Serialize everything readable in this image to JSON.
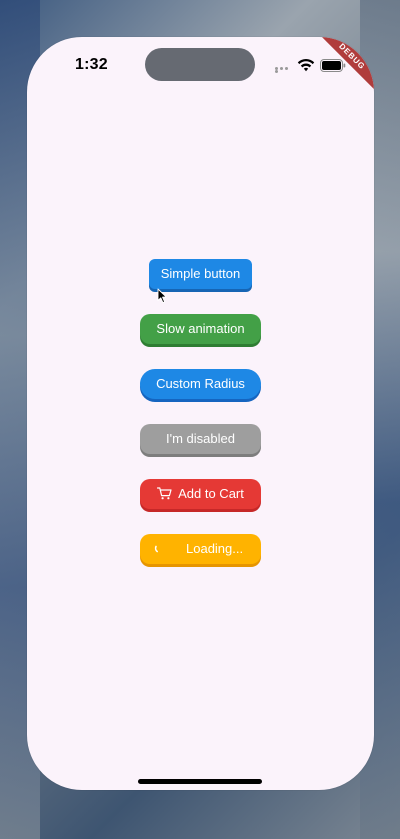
{
  "status_bar": {
    "time": "1:32"
  },
  "debug_banner": {
    "label": "DEBUG"
  },
  "buttons": {
    "simple": "Simple button",
    "slow": "Slow animation",
    "radius": "Custom Radius",
    "disabled": "I'm disabled",
    "cart": "Add to Cart",
    "loading": "Loading..."
  },
  "icons": {
    "cart": "shopping-cart-icon",
    "spinner": "spinner-icon",
    "wifi": "wifi-icon",
    "battery": "battery-icon",
    "cursor": "mouse-pointer-icon"
  },
  "colors": {
    "background": "#fbf3fb",
    "simple": "#1e88e5",
    "slow": "#43a047",
    "radius": "#1e88e5",
    "disabled": "#9e9e9e",
    "cart": "#e53935",
    "loading": "#ffb300",
    "debug": "#b03c3c"
  }
}
